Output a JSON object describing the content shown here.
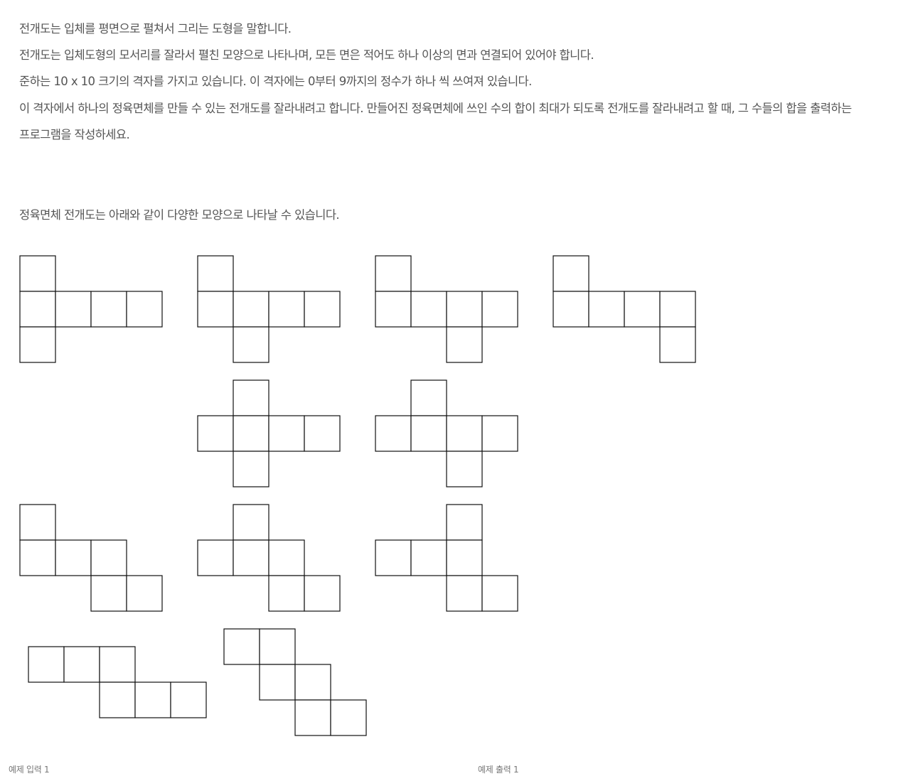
{
  "problem": {
    "lines": [
      "전개도는 입체를 평면으로 펼쳐서 그리는 도형을 말합니다.",
      "전개도는 입체도형의 모서리를 잘라서 펼친 모양으로 나타나며, 모든 면은 적어도 하나 이상의 면과 연결되어 있어야 합니다.",
      "준하는 10 x 10 크기의 격자를 가지고 있습니다. 이 격자에는 0부터 9까지의 정수가 하나 씩 쓰여져 있습니다.",
      "이 격자에서 하나의 정육면체를 만들 수 있는 전개도를 잘라내려고 합니다. 만들어진 정육면체에 쓰인 수의 합이 최대가 되도록 전개도를 잘라내려고 할 때, 그 수들의 합을 출력하는",
      "프로그램을 작성하세요."
    ],
    "nets_intro": "정육면체 전개도는 아래와 같이 다양한 모양으로 나타날 수 있습니다."
  },
  "nets": [
    [
      [
        0,
        0
      ],
      [
        0,
        1
      ],
      [
        1,
        1
      ],
      [
        2,
        1
      ],
      [
        3,
        1
      ],
      [
        0,
        2
      ]
    ],
    [
      [
        0,
        0
      ],
      [
        0,
        1
      ],
      [
        1,
        1
      ],
      [
        2,
        1
      ],
      [
        3,
        1
      ],
      [
        1,
        2
      ]
    ],
    [
      [
        0,
        0
      ],
      [
        0,
        1
      ],
      [
        1,
        1
      ],
      [
        2,
        1
      ],
      [
        3,
        1
      ],
      [
        2,
        2
      ]
    ],
    [
      [
        0,
        0
      ],
      [
        0,
        1
      ],
      [
        1,
        1
      ],
      [
        2,
        1
      ],
      [
        3,
        1
      ],
      [
        3,
        2
      ]
    ],
    [
      [
        1,
        0
      ],
      [
        0,
        1
      ],
      [
        1,
        1
      ],
      [
        2,
        1
      ],
      [
        3,
        1
      ],
      [
        1,
        2
      ]
    ],
    [
      [
        1,
        0
      ],
      [
        0,
        1
      ],
      [
        1,
        1
      ],
      [
        2,
        1
      ],
      [
        3,
        1
      ],
      [
        2,
        2
      ]
    ],
    [
      [
        0,
        0
      ],
      [
        0,
        1
      ],
      [
        1,
        1
      ],
      [
        2,
        1
      ],
      [
        2,
        2
      ],
      [
        3,
        2
      ]
    ],
    [
      [
        1,
        0
      ],
      [
        0,
        1
      ],
      [
        1,
        1
      ],
      [
        2,
        1
      ],
      [
        2,
        2
      ],
      [
        3,
        2
      ]
    ],
    [
      [
        2,
        0
      ],
      [
        0,
        1
      ],
      [
        1,
        1
      ],
      [
        2,
        1
      ],
      [
        2,
        2
      ],
      [
        3,
        2
      ]
    ],
    [
      [
        0,
        0
      ],
      [
        1,
        0
      ],
      [
        2,
        0
      ],
      [
        2,
        1
      ],
      [
        3,
        1
      ],
      [
        4,
        1
      ]
    ],
    [
      [
        0,
        0
      ],
      [
        1,
        0
      ],
      [
        1,
        1
      ],
      [
        2,
        1
      ],
      [
        2,
        2
      ],
      [
        3,
        2
      ]
    ]
  ],
  "bottom_cutoff": {
    "left": "예제 입력 1",
    "right": "예제 출력 1"
  }
}
